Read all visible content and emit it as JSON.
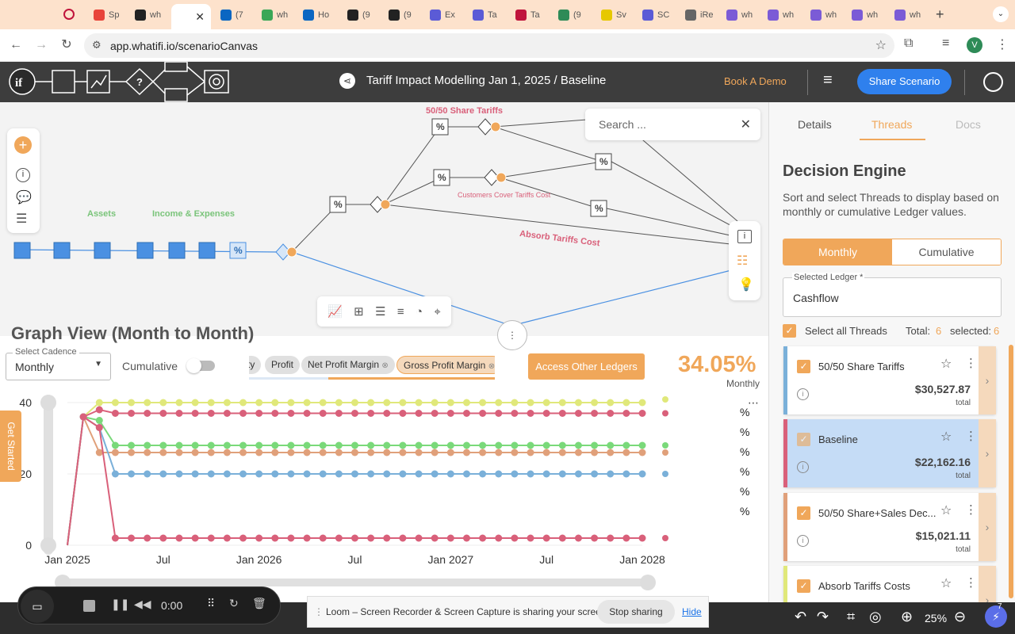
{
  "browser": {
    "tabs": [
      {
        "title": "Sp",
        "color": "#e8443a"
      },
      {
        "title": "wh",
        "color": "#222"
      },
      {
        "title": "(7",
        "color": "#0a66c2"
      },
      {
        "title": "wh",
        "color": "#3aa757"
      },
      {
        "title": "Ho",
        "color": "#0a66c2"
      },
      {
        "title": "(9",
        "color": "#222"
      },
      {
        "title": "(9",
        "color": "#222"
      },
      {
        "title": "Ex",
        "color": "#5b5bd6"
      },
      {
        "title": "Ta",
        "color": "#5b5bd6"
      },
      {
        "title": "Ta",
        "color": "#c0143c"
      },
      {
        "title": "(9",
        "color": "#2e8b57"
      },
      {
        "title": "Sv",
        "color": "#e6c800"
      },
      {
        "title": "SC",
        "color": "#5b5bd6"
      },
      {
        "title": "iRe",
        "color": "#666"
      },
      {
        "title": "wh",
        "color": "#7b5bd6"
      },
      {
        "title": "wh",
        "color": "#7b5bd6"
      },
      {
        "title": "wh",
        "color": "#7b5bd6"
      },
      {
        "title": "wh",
        "color": "#7b5bd6"
      },
      {
        "title": "wh",
        "color": "#7b5bd6"
      }
    ],
    "url": "app.whatifi.io/scenarioCanvas",
    "profile_initial": "V"
  },
  "app": {
    "breadcrumb": "Tariff Impact Modelling Jan 1, 2025 / Baseline",
    "book_demo": "Book A Demo",
    "share_button": "Share Scenario"
  },
  "canvas": {
    "search_placeholder": "Search ...",
    "labels": {
      "assets": "Assets",
      "income_expenses": "Income & Expenses",
      "share_tariffs": "50/50 Share Tariffs",
      "customers_cover": "Customers Cover Tariffs Cost",
      "absorb": "Absorb Tariffs Cost"
    }
  },
  "graph": {
    "title": "Graph View (Month to Month)",
    "cadence_label": "Select Cadence",
    "cadence_value": "Monthly",
    "cumulative_label": "Cumulative",
    "chips": [
      "ty",
      "Profit",
      "Net Profit Margin",
      "Gross Profit Margin"
    ],
    "access_button": "Access Other Ledgers",
    "value": "34.05%",
    "value_sub": "Monthly",
    "pct_symbols": [
      "%",
      "%",
      "%",
      "%",
      "%",
      "%"
    ]
  },
  "chart_data": {
    "type": "line",
    "x_ticks": [
      "Jan 2025",
      "Jul",
      "Jan 2026",
      "Jul",
      "Jan 2027",
      "Jul",
      "Jan 2028"
    ],
    "y_ticks": [
      0,
      20,
      40
    ],
    "ylim": [
      0,
      40
    ],
    "series": [
      {
        "color": "#e0e87a",
        "values": [
          0,
          36,
          40,
          40,
          40,
          40,
          40,
          40,
          40,
          40,
          40,
          40,
          40,
          40,
          40,
          40,
          40,
          40,
          40,
          40,
          40,
          40,
          40,
          40,
          40,
          40,
          40,
          40,
          40,
          40,
          40,
          40,
          40,
          40,
          40,
          40,
          40
        ]
      },
      {
        "color": "#d9607a",
        "values": [
          0,
          36,
          38,
          37,
          37,
          37,
          37,
          37,
          37,
          37,
          37,
          37,
          37,
          37,
          37,
          37,
          37,
          37,
          37,
          37,
          37,
          37,
          37,
          37,
          37,
          37,
          37,
          37,
          37,
          37,
          37,
          37,
          37,
          37,
          37,
          37,
          37
        ]
      },
      {
        "color": "#7ad97a",
        "values": [
          0,
          36,
          35,
          28,
          28,
          28,
          28,
          28,
          28,
          28,
          28,
          28,
          28,
          28,
          28,
          28,
          28,
          28,
          28,
          28,
          28,
          28,
          28,
          28,
          28,
          28,
          28,
          28,
          28,
          28,
          28,
          28,
          28,
          28,
          28,
          28,
          28
        ]
      },
      {
        "color": "#e0a07a",
        "values": [
          0,
          36,
          26,
          26,
          26,
          26,
          26,
          26,
          26,
          26,
          26,
          26,
          26,
          26,
          26,
          26,
          26,
          26,
          26,
          26,
          26,
          26,
          26,
          26,
          26,
          26,
          26,
          26,
          26,
          26,
          26,
          26,
          26,
          26,
          26,
          26,
          26
        ]
      },
      {
        "color": "#7ab0d9",
        "values": [
          0,
          36,
          33,
          20,
          20,
          20,
          20,
          20,
          20,
          20,
          20,
          20,
          20,
          20,
          20,
          20,
          20,
          20,
          20,
          20,
          20,
          20,
          20,
          20,
          20,
          20,
          20,
          20,
          20,
          20,
          20,
          20,
          20,
          20,
          20,
          20,
          20
        ]
      },
      {
        "color": "#d9607a",
        "values": [
          0,
          36,
          33,
          2,
          2,
          2,
          2,
          2,
          2,
          2,
          2,
          2,
          2,
          2,
          2,
          2,
          2,
          2,
          2,
          2,
          2,
          2,
          2,
          2,
          2,
          2,
          2,
          2,
          2,
          2,
          2,
          2,
          2,
          2,
          2,
          2,
          2
        ]
      }
    ]
  },
  "panel": {
    "tabs": [
      "Details",
      "Threads",
      "Docs"
    ],
    "title": "Decision Engine",
    "desc": "Sort and select Threads to display based on monthly or cumulative Ledger values.",
    "toggle_monthly": "Monthly",
    "toggle_cumulative": "Cumulative",
    "ledger_label": "Selected Ledger *",
    "ledger_value": "Cashflow",
    "select_all": "Select all Threads",
    "total_label": "Total:",
    "total_value": "6",
    "selected_label": "selected:",
    "selected_value": "6",
    "threads": [
      {
        "name": "50/50 Share Tariffs",
        "amount": "$30,527.87",
        "sub": "total",
        "color": "#7ab0d9"
      },
      {
        "name": "Baseline",
        "amount": "$22,162.16",
        "sub": "total",
        "color": "#d9607a"
      },
      {
        "name": "50/50 Share+Sales Dec...",
        "amount": "$15,021.11",
        "sub": "total",
        "color": "#e0a07a"
      },
      {
        "name": "Absorb Tariffs Costs",
        "amount": "",
        "sub": "",
        "color": "#e0e87a"
      }
    ]
  },
  "sidebar": {
    "get_started": "Get Started"
  },
  "loom": {
    "timer": "0:00",
    "message": "Loom – Screen Recorder & Screen Capture is sharing your screen.",
    "stop": "Stop sharing",
    "hide": "Hide"
  },
  "zoom": {
    "value": "25%"
  },
  "notification_count": "7"
}
